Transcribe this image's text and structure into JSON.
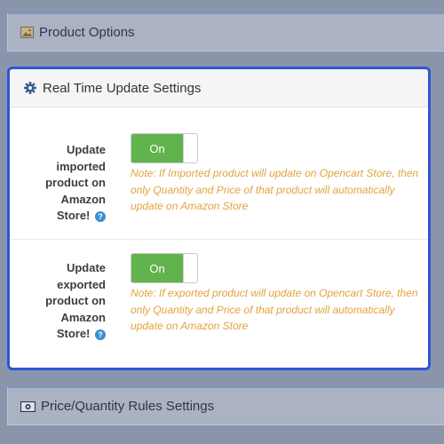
{
  "panels": {
    "product_options": {
      "title": "Product Options",
      "icon": "image-icon"
    },
    "price_quantity": {
      "title": "Price/Quantity Rules Settings",
      "icon": "money-icon"
    }
  },
  "realtime": {
    "title": "Real Time Update Settings",
    "icon": "gear-icon",
    "settings": [
      {
        "label_lines": [
          "Update",
          "imported",
          "product on",
          "Amazon",
          "Store!"
        ],
        "help": "?",
        "toggle_label": "On",
        "toggle_state": "on",
        "note": "Note: If Imported product will update on Opencart Store, then only Quantity and Price of that product will automatically update on Amazon Store"
      },
      {
        "label_lines": [
          "Update",
          "exported",
          "product on",
          "Amazon",
          "Store!"
        ],
        "help": "?",
        "toggle_label": "On",
        "toggle_state": "on",
        "note": "Note: If exported product will update on Opencart Store, then only Quantity and Price of that product will automatically update on Amazon Store"
      }
    ]
  },
  "colors": {
    "toggle_on": "#61b34d",
    "note": "#e3a33f",
    "help": "#3a8fd1",
    "modal_border": "#2f55d4"
  }
}
